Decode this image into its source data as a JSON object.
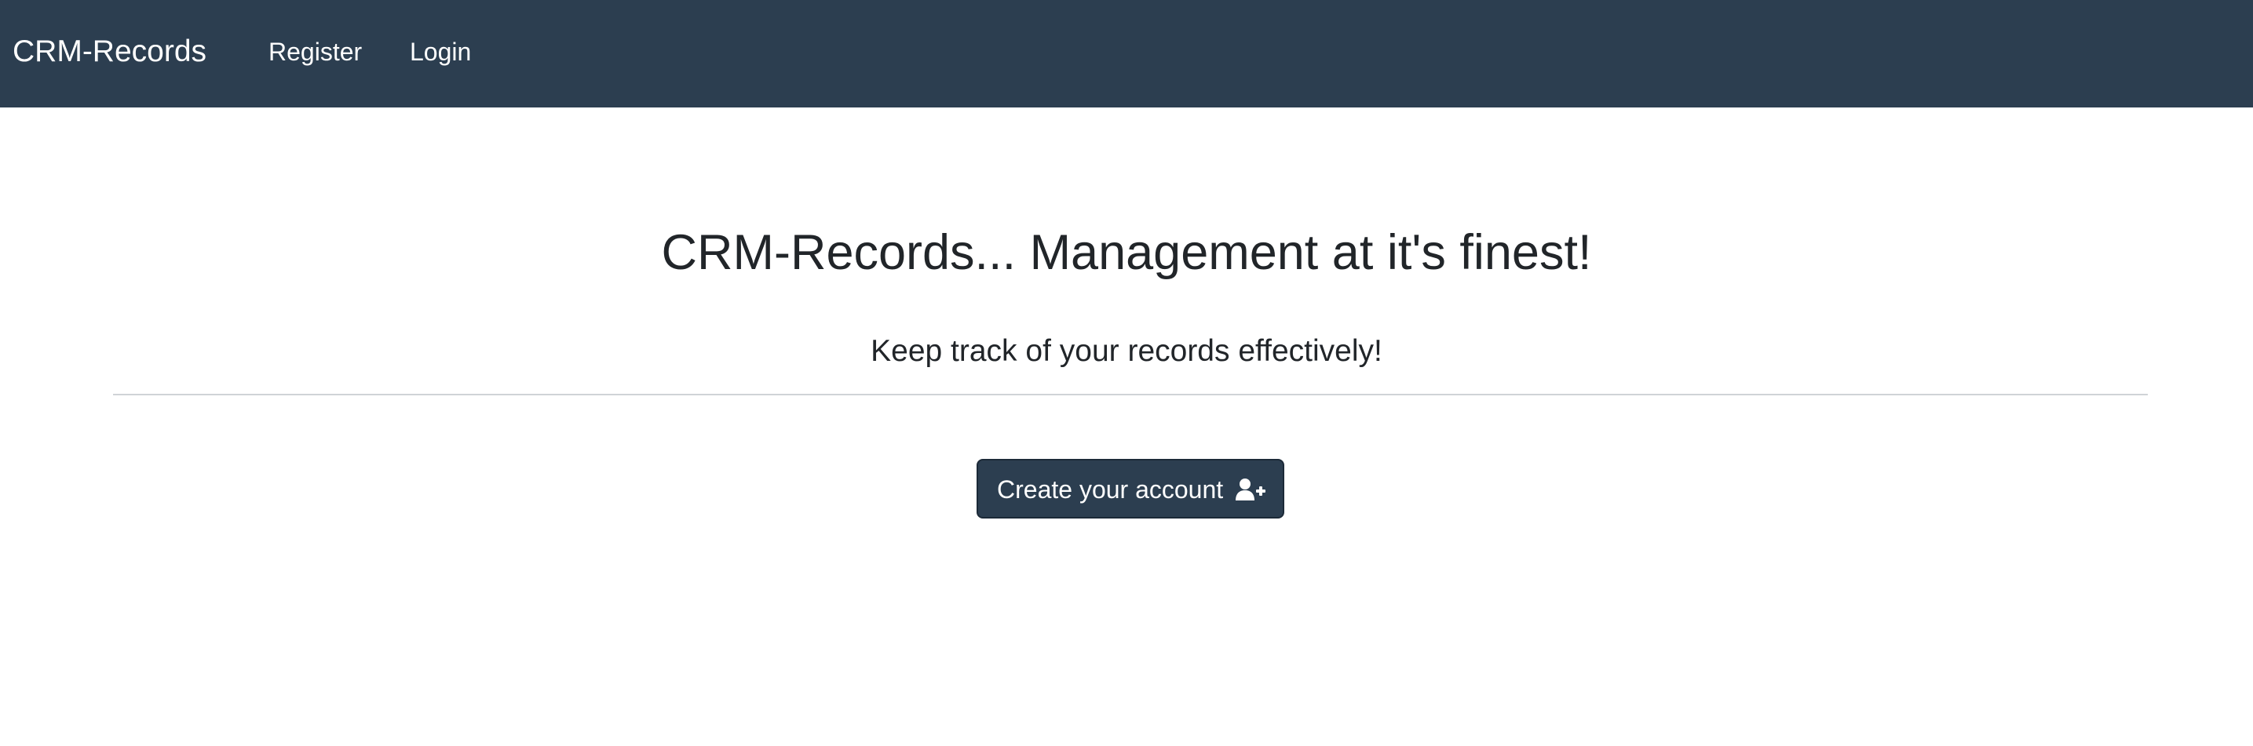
{
  "navbar": {
    "brand": "CRM-Records",
    "links": [
      {
        "label": "Register"
      },
      {
        "label": "Login"
      }
    ],
    "background": "#2c3e50"
  },
  "hero": {
    "title": "CRM-Records... Management at it's finest!",
    "subtitle": "Keep track of your records effectively!"
  },
  "cta": {
    "label": "Create your account",
    "icon": "user-plus-icon",
    "color": "#2c3e50"
  }
}
